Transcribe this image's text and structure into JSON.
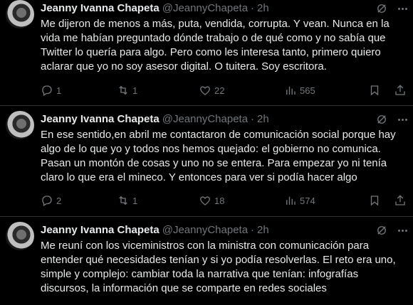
{
  "tweets": [
    {
      "author_name": "Jeanny Ivanna Chapeta",
      "handle": "@JeannyChapeta",
      "separator": "·",
      "time": "2h",
      "text": "Me dijeron de menos a más, puta, vendida, corrupta. Y vean. Nunca en la\nvida me habían preguntado dónde trabajo o de qué como y no sabía que\nTwitter lo quería para algo. Pero como les interesa tanto, primero quiero\naclarar que yo no soy asesor digital. O tuitera. Soy escritora.",
      "replies": "1",
      "retweets": "1",
      "likes": "22",
      "views": "565"
    },
    {
      "author_name": "Jeanny Ivanna Chapeta",
      "handle": "@JeannyChapeta",
      "separator": "·",
      "time": "2h",
      "text": "En ese sentido,en abril me contactaron de comunicación social porque hay\nalgo de lo que yo y todos nos hemos quejado: el gobierno no comunica.\nPasan un montón de cosas y uno no se entera. Para empezar yo ni tenía\nclaro lo que era el mineco. Y entonces para ver si podía hacer algo",
      "replies": "2",
      "retweets": "1",
      "likes": "18",
      "views": "574"
    },
    {
      "author_name": "Jeanny Ivanna Chapeta",
      "handle": "@JeannyChapeta",
      "separator": "·",
      "time": "2h",
      "text": "Me reuní con los viceministros con la ministra con comunicación para\nentender qué necesidades tenían y si yo podía resolverlas. El reto era uno,\nsimple y complejo: cambiar toda la narrativa que tenían: infografías\ndiscursos, la información que se comparte en redes sociales"
    }
  ],
  "icons": [
    "grok-icon",
    "more-icon",
    "reply-icon",
    "retweet-icon",
    "like-icon",
    "views-icon",
    "bookmark-icon",
    "share-icon"
  ],
  "colors": {
    "background": "#000000",
    "text": "#e7e9ea",
    "muted": "#71767b",
    "divider": "#2f3336"
  }
}
